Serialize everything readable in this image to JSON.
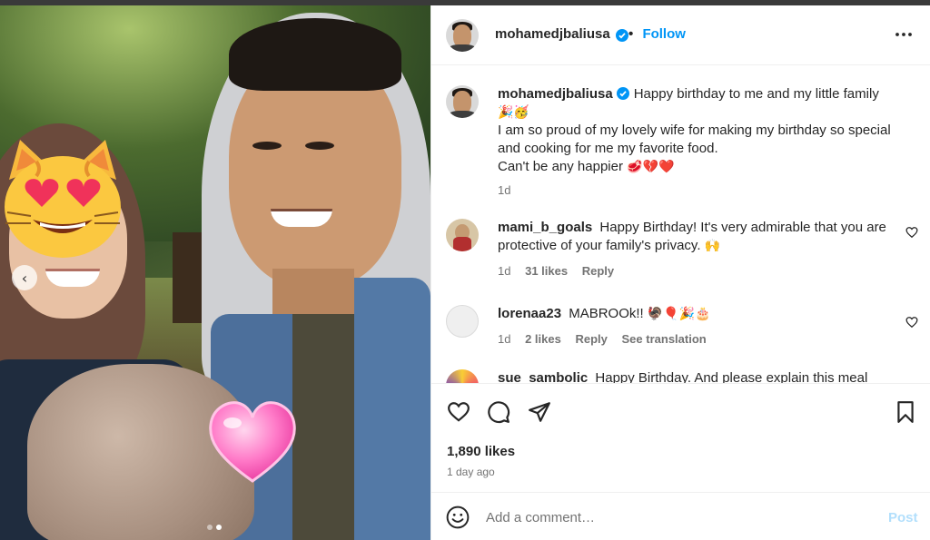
{
  "post": {
    "username": "mohamedjbaliusa",
    "follow_label": "Follow",
    "dot_separator": "•"
  },
  "caption": {
    "username": "mohamedjbaliusa",
    "line1": "Happy birthday to me and my little family",
    "line1_emoji": "🎉🥳",
    "line2": "I am so proud of my lovely wife for making my birthday so special and cooking for me my favorite food.",
    "line3": "Can't be any happier",
    "line3_emoji": "🥩💔❤️",
    "time": "1d"
  },
  "comments": [
    {
      "username": "mami_b_goals",
      "text": "Happy Birthday! It's very admirable that you are protective of your family's privacy.",
      "emoji": "🙌",
      "time": "1d",
      "likes": "31 likes",
      "reply_label": "Reply"
    },
    {
      "username": "lorenaa23",
      "text": "MABROOk!!",
      "emoji": "🦃🎈🎉🎂",
      "time": "1d",
      "likes": "2 likes",
      "reply_label": "Reply",
      "translation_label": "See translation"
    },
    {
      "username": "sue_sambolic",
      "text": "Happy Birthday. And please explain this meal"
    }
  ],
  "actions": {
    "likes_count": "1,890 likes",
    "posted_ago": "1 day ago"
  },
  "comment_box": {
    "placeholder": "Add a comment…",
    "post_label": "Post"
  },
  "media": {
    "overlay_emoji_1": "smiling-cat-heart-eyes",
    "overlay_emoji_2": "pink-heart",
    "carousel_current": 2,
    "carousel_total": 2
  },
  "colors": {
    "accent": "#0095f6",
    "post_disabled": "#b2dffc",
    "verified": "#0095f6"
  }
}
